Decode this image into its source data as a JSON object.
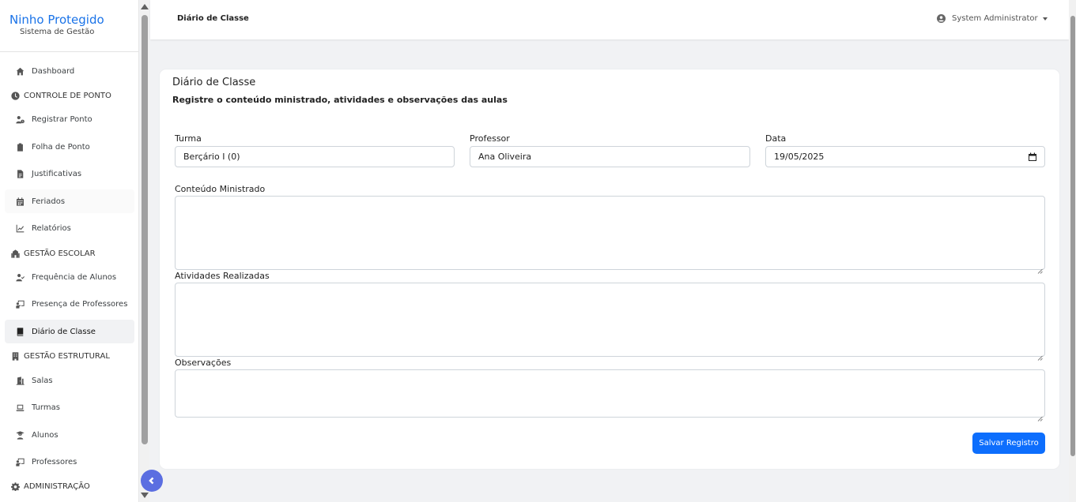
{
  "brand": {
    "title": "Ninho Protegido",
    "subtitle": "Sistema de Gestão"
  },
  "sidebar": {
    "items": [
      {
        "type": "item",
        "label": "Dashboard",
        "icon": "home-icon"
      },
      {
        "type": "section",
        "label": "CONTROLE DE PONTO",
        "icon": "clock-icon"
      },
      {
        "type": "item",
        "label": "Registrar Ponto",
        "icon": "user-clock-icon"
      },
      {
        "type": "item",
        "label": "Folha de Ponto",
        "icon": "clipboard-icon"
      },
      {
        "type": "item",
        "label": "Justificativas",
        "icon": "file-icon"
      },
      {
        "type": "item",
        "label": "Feriados",
        "icon": "calendar-icon"
      },
      {
        "type": "item",
        "label": "Relatórios",
        "icon": "chart-line-icon"
      },
      {
        "type": "section",
        "label": "GESTÃO ESCOLAR",
        "icon": "school-icon"
      },
      {
        "type": "item",
        "label": "Frequência de Alunos",
        "icon": "user-check-icon"
      },
      {
        "type": "item",
        "label": "Presença de Professores",
        "icon": "chalkboard-teacher-icon"
      },
      {
        "type": "item",
        "label": "Diário de Classe",
        "icon": "book-icon",
        "active": true
      },
      {
        "type": "section",
        "label": "GESTÃO ESTRUTURAL",
        "icon": "building-icon"
      },
      {
        "type": "item",
        "label": "Salas",
        "icon": "door-icon"
      },
      {
        "type": "item",
        "label": "Turmas",
        "icon": "laptop-icon"
      },
      {
        "type": "item",
        "label": "Alunos",
        "icon": "graduate-icon"
      },
      {
        "type": "item",
        "label": "Professores",
        "icon": "chalkboard-teacher-icon"
      },
      {
        "type": "section",
        "label": "ADMINISTRAÇÃO",
        "icon": "gear-icon"
      }
    ]
  },
  "topbar": {
    "title": "Diário de Classe",
    "user": "System Administrator"
  },
  "card": {
    "title": "Diário de Classe",
    "subtitle": "Registre o conteúdo ministrado, atividades e observações das aulas"
  },
  "form": {
    "turma_label": "Turma",
    "turma_value": "Berçário I (0)",
    "professor_label": "Professor",
    "professor_value": "Ana Oliveira",
    "data_label": "Data",
    "data_value": "19/05/2025",
    "conteudo_label": "Conteúdo Ministrado",
    "atividades_label": "Atividades Realizadas",
    "observacoes_label": "Observações",
    "save_label": "Salvar Registro"
  },
  "colors": {
    "brand": "#1a73e8",
    "primary_button": "#0d6efd",
    "collapse_button": "#5b6ee1"
  }
}
